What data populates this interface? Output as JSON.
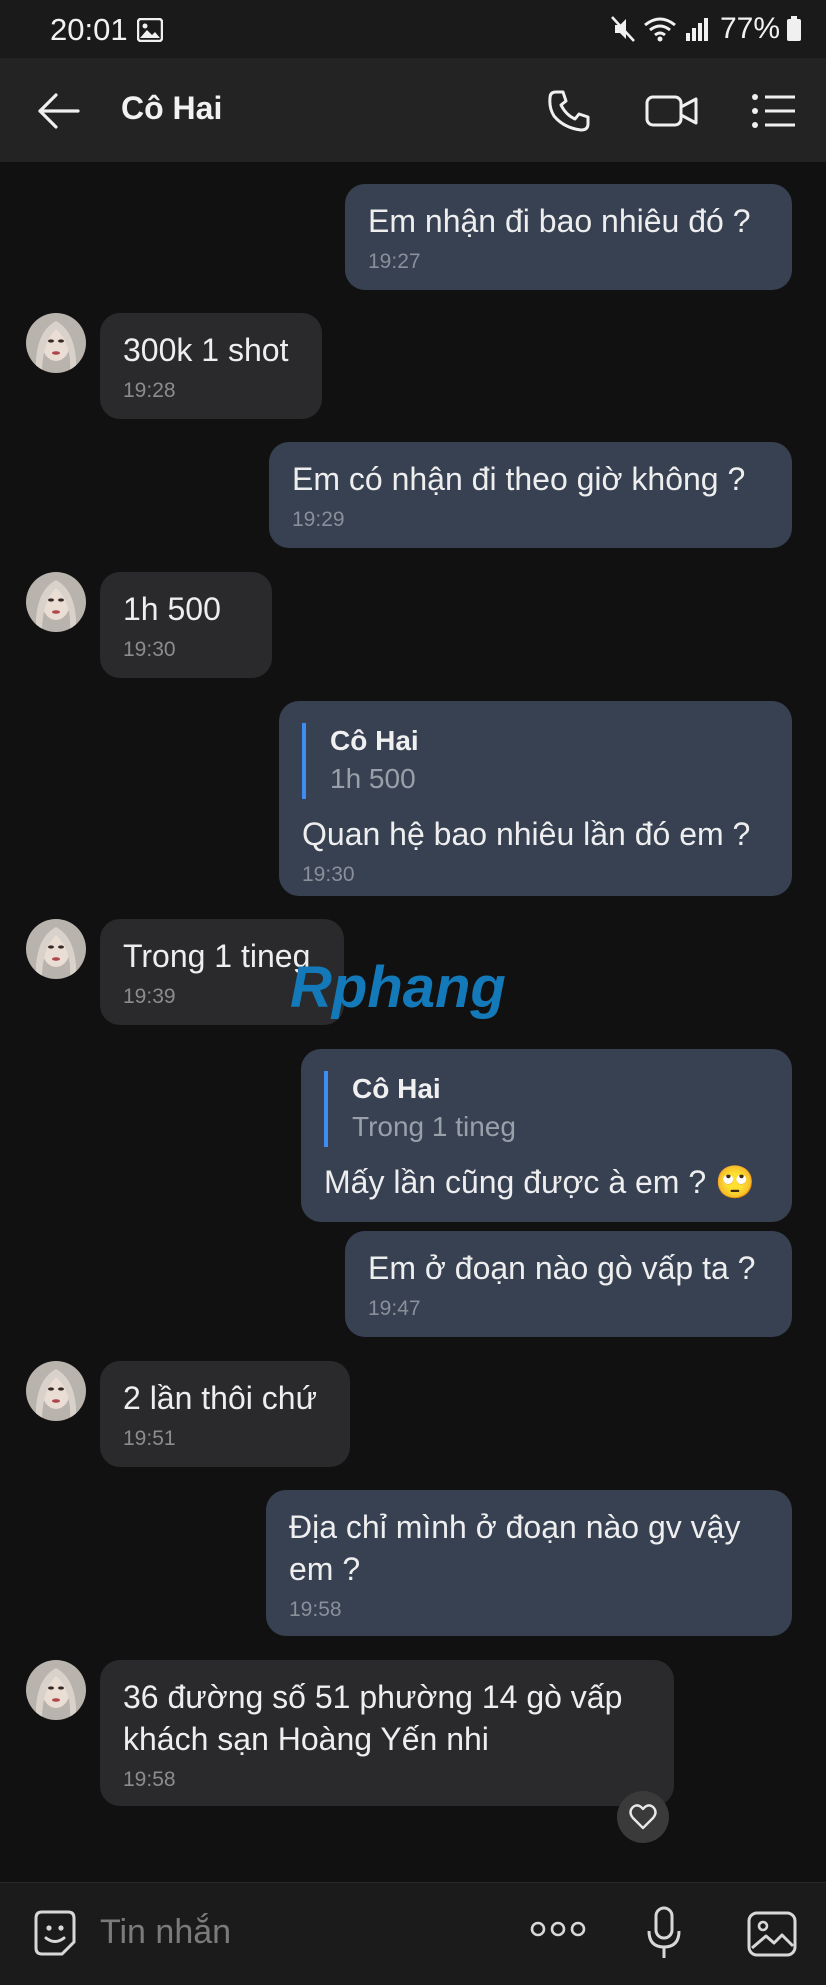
{
  "status_bar": {
    "time": "20:01",
    "battery": "77%"
  },
  "header": {
    "title": "Cô Hai"
  },
  "messages": [
    {
      "dir": "out",
      "text": "Em nhận đi bao nhiêu đó ?",
      "time": "19:27"
    },
    {
      "dir": "in",
      "text": "300k 1 shot",
      "time": "19:28"
    },
    {
      "dir": "out",
      "text": "Em có nhận đi theo giờ không ?",
      "time": "19:29"
    },
    {
      "dir": "in",
      "text": "1h 500",
      "time": "19:30"
    },
    {
      "dir": "out",
      "quote_name": "Cô Hai",
      "quote_text": "1h 500",
      "text": "Quan hệ bao nhiêu lần đó em ?",
      "time": "19:30"
    },
    {
      "dir": "in",
      "text": "Trong 1 tineg",
      "time": "19:39"
    },
    {
      "dir": "out",
      "quote_name": "Cô Hai",
      "quote_text": "Trong 1 tineg",
      "text": "Mấy lần cũng được à em ?",
      "emoji": "🙄",
      "time": ""
    },
    {
      "dir": "out",
      "text": "Em ở đoạn nào gò vấp ta ?",
      "time": "19:47"
    },
    {
      "dir": "in",
      "text": "2 lần thôi chứ",
      "time": "19:51"
    },
    {
      "dir": "out",
      "text": "Địa chỉ mình ở đoạn nào gv vậy\nem ?",
      "time": "19:58"
    },
    {
      "dir": "in",
      "text": "36 đường số 51 phường 14 gò vấp\nkhách sạn Hoàng Yến nhi",
      "time": "19:58",
      "reaction": "heart-icon"
    }
  ],
  "watermark": "Rphang",
  "input": {
    "placeholder": "Tin nhắn"
  },
  "colors": {
    "outgoing_bubble": "#374152",
    "incoming_bubble": "#2a2a2c",
    "quote_bar": "#3d8df5",
    "background": "#111111"
  }
}
